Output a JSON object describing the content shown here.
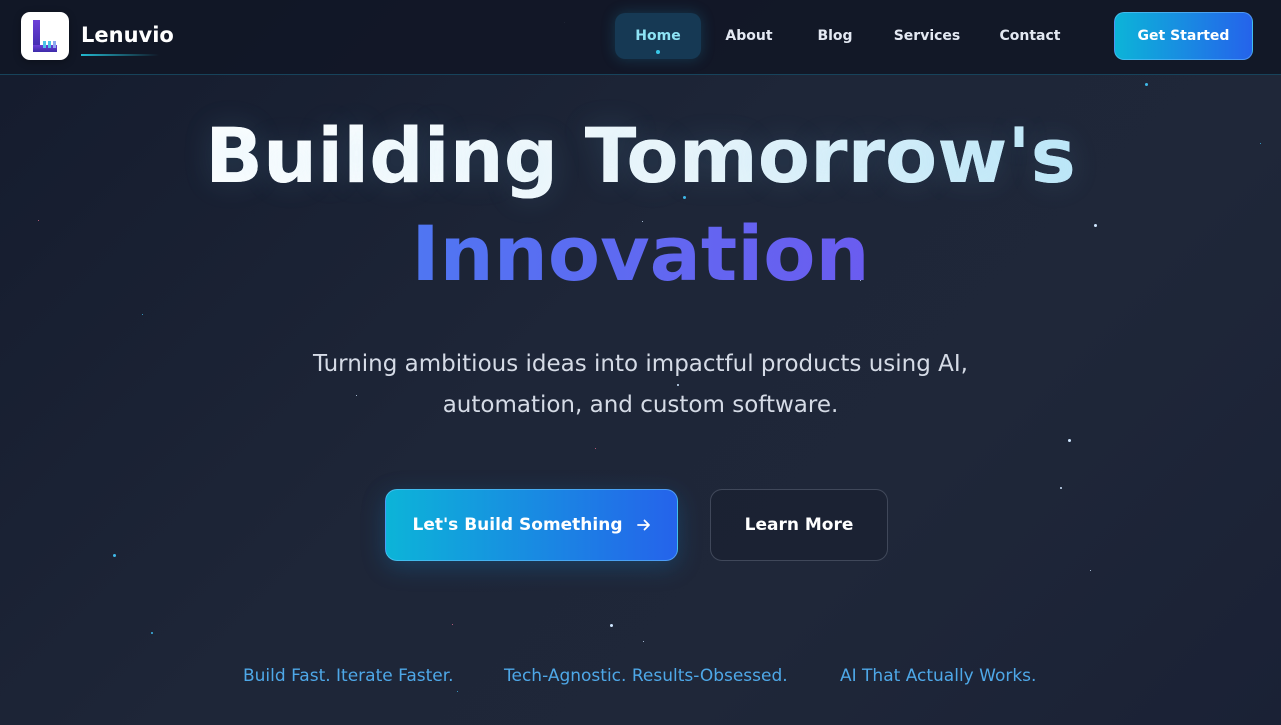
{
  "brand": {
    "name": "Lenuvio",
    "logo_icon": "lenuvio-logo-icon"
  },
  "nav": {
    "items": [
      {
        "label": "Home",
        "active": true
      },
      {
        "label": "About",
        "active": false
      },
      {
        "label": "Blog",
        "active": false
      },
      {
        "label": "Services",
        "active": false
      },
      {
        "label": "Contact",
        "active": false
      }
    ],
    "cta_label": "Get Started"
  },
  "hero": {
    "title_line1": "Building Tomorrow's",
    "title_line2": "Innovation",
    "subtitle": "Turning ambitious ideas into impactful products using AI, automation, and custom software.",
    "primary_button": {
      "label": "Let's Build Something",
      "icon": "arrow-right-icon"
    },
    "secondary_button": {
      "label": "Learn More"
    }
  },
  "taglines": [
    "Build Fast. Iterate Faster.",
    "Tech-Agnostic. Results-Obsessed.",
    "AI That Actually Works."
  ],
  "colors": {
    "accent_cyan": "#0cb4d8",
    "accent_blue": "#2563eb",
    "gradient_text_violet": "#6366f1",
    "tagline": "#4ea8e8",
    "background": "#1e2638"
  }
}
